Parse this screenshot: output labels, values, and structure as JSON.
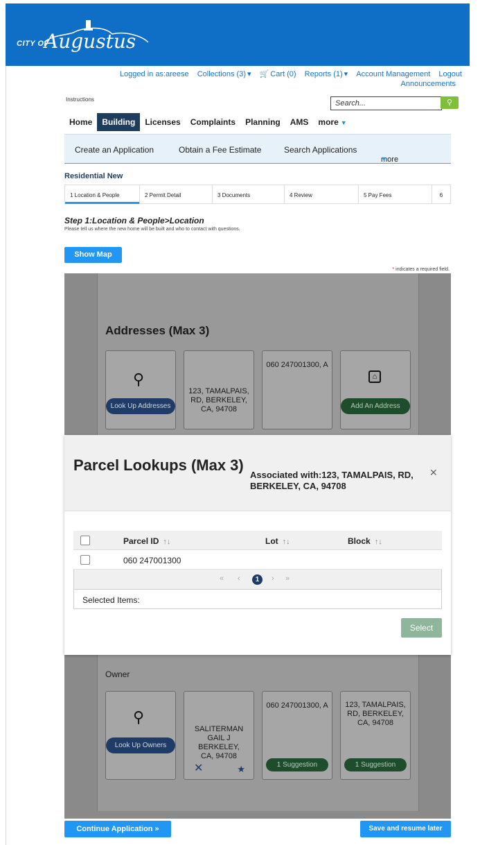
{
  "brand": {
    "city": "CITY OF",
    "name": "Augustus",
    "banner_color": "#0f6fc6"
  },
  "toplinks": {
    "logged_in": "Logged in as:areese",
    "collections": "Collections (3)",
    "cart": "Cart (0)",
    "reports": "Reports (1)",
    "account": "Account Management",
    "logout": "Logout",
    "announcements": "Announcements"
  },
  "instructions": "Instructions",
  "search": {
    "placeholder": "Search..."
  },
  "mainnav": [
    "Home",
    "Building",
    "Licenses",
    "Complaints",
    "Planning",
    "AMS",
    "more"
  ],
  "subnav": {
    "create": "Create an Application",
    "estimate": "Obtain a Fee Estimate",
    "search": "Search Applications",
    "more": "more"
  },
  "record_type": "Residential New",
  "steps": [
    "1 Location & People",
    "2 Permit Detail",
    "3 Documents",
    "4 Review",
    "5 Pay Fees",
    "6"
  ],
  "step_title": "Step 1:Location & People>Location",
  "step_subtitle": "Please tell us where the new home will be built and who to contact with questions.",
  "show_map": "Show Map",
  "required_note": "indicates a required field.",
  "addresses": {
    "title": "Addresses (Max 3)",
    "lookup_label": "Look Up Addresses",
    "address_card": "123, TAMALPAIS, RD, BERKELEY, CA, 94708",
    "parcel_card": "060 247001300, A",
    "add_label": "Add An Address"
  },
  "modal": {
    "title": "Parcel Lookups (Max 3)",
    "associated": "Associated with:123, TAMALPAIS, RD, BERKELEY, CA, 94708",
    "columns": [
      "Parcel ID",
      "Lot",
      "Block"
    ],
    "rows": [
      {
        "parcel_id": "060 247001300",
        "lot": "",
        "block": ""
      }
    ],
    "pager": {
      "first": "«",
      "prev": "‹",
      "page": "1",
      "next": "›",
      "last": "»"
    },
    "selected_items": "Selected Items:",
    "select_button": "Select"
  },
  "owners": {
    "label": "Owner",
    "lookup_label": "Look Up Owners",
    "owner_card": "SALITERMAN GAIL J BERKELEY, CA, 94708",
    "parcel_card": "060 247001300, A",
    "address_card": "123, TAMALPAIS, RD, BERKELEY, CA, 94708",
    "suggestion": "1 Suggestion"
  },
  "footer": {
    "continue": "Continue Application »",
    "save": "Save and resume later"
  }
}
